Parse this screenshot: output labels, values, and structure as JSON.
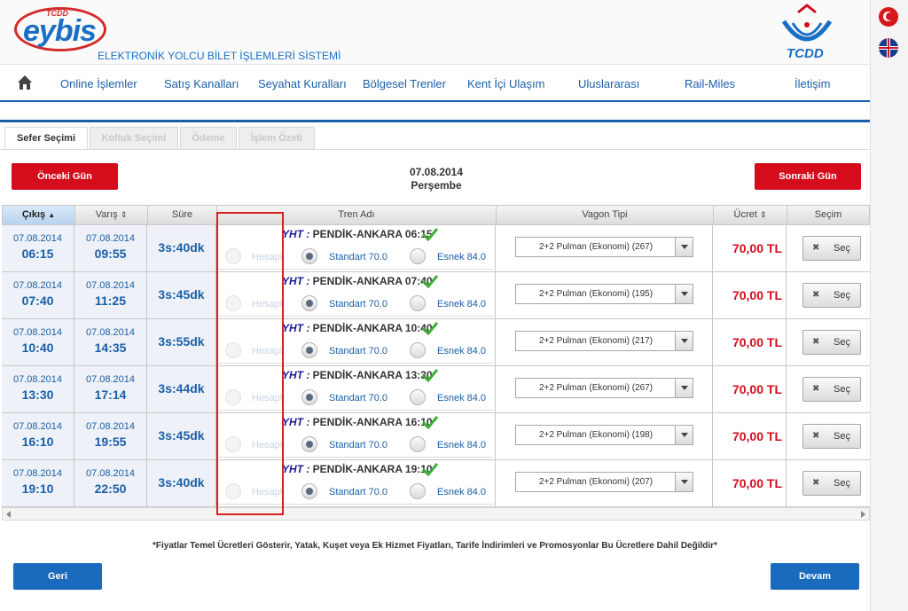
{
  "header": {
    "logo_small": "TCDD",
    "logo_main": "eybis",
    "site_title": "ELEKTRONİK YOLCU BİLET İŞLEMLERİ SİSTEMİ",
    "brand": "TCDD"
  },
  "nav": {
    "items": [
      "Online İşlemler",
      "Satış Kanalları",
      "Seyahat Kuralları",
      "Bölgesel Trenler",
      "Kent İçi Ulaşım",
      "Uluslararası",
      "Rail-Miles",
      "İletişim"
    ]
  },
  "tabs": [
    "Sefer Seçimi",
    "Koltuk Seçimi",
    "Ödeme",
    "İşlem Özeti"
  ],
  "date_nav": {
    "prev": "Önceki Gün",
    "next": "Sonraki Gün",
    "date": "07.08.2014",
    "weekday": "Perşembe"
  },
  "table": {
    "headers": {
      "departure": "Çıkış",
      "arrival": "Varış",
      "duration": "Süre",
      "train": "Tren Adı",
      "wagon": "Vagon Tipi",
      "price": "Ücret",
      "select": "Seçim"
    },
    "rows": [
      {
        "dep_date": "07.08.2014",
        "dep_time": "06:15",
        "arr_date": "07.08.2014",
        "arr_time": "09:55",
        "duration": "3s:40dk",
        "train_prefix": "YHT :",
        "train_name": " PENDİK-ANKARA 06:15",
        "opt1": "Hesaplı",
        "opt2": "Standart 70.0",
        "opt3": "Esnek 84.0",
        "wagon": "2+2 Pulman (Ekonomi) (267)",
        "price": "70,00 TL",
        "btn": "Seç"
      },
      {
        "dep_date": "07.08.2014",
        "dep_time": "07:40",
        "arr_date": "07.08.2014",
        "arr_time": "11:25",
        "duration": "3s:45dk",
        "train_prefix": "YHT :",
        "train_name": " PENDİK-ANKARA 07:40",
        "opt1": "Hesaplı",
        "opt2": "Standart 70.0",
        "opt3": "Esnek 84.0",
        "wagon": "2+2 Pulman (Ekonomi) (195)",
        "price": "70,00 TL",
        "btn": "Seç"
      },
      {
        "dep_date": "07.08.2014",
        "dep_time": "10:40",
        "arr_date": "07.08.2014",
        "arr_time": "14:35",
        "duration": "3s:55dk",
        "train_prefix": "YHT :",
        "train_name": " PENDİK-ANKARA 10:40",
        "opt1": "Hesaplı",
        "opt2": "Standart 70.0",
        "opt3": "Esnek 84.0",
        "wagon": "2+2 Pulman (Ekonomi) (217)",
        "price": "70,00 TL",
        "btn": "Seç"
      },
      {
        "dep_date": "07.08.2014",
        "dep_time": "13:30",
        "arr_date": "07.08.2014",
        "arr_time": "17:14",
        "duration": "3s:44dk",
        "train_prefix": "YHT :",
        "train_name": " PENDİK-ANKARA 13:30",
        "opt1": "Hesaplı",
        "opt2": "Standart 70.0",
        "opt3": "Esnek 84.0",
        "wagon": "2+2 Pulman (Ekonomi) (267)",
        "price": "70,00 TL",
        "btn": "Seç"
      },
      {
        "dep_date": "07.08.2014",
        "dep_time": "16:10",
        "arr_date": "07.08.2014",
        "arr_time": "19:55",
        "duration": "3s:45dk",
        "train_prefix": "YHT :",
        "train_name": " PENDİK-ANKARA 16:10",
        "opt1": "Hesaplı",
        "opt2": "Standart 70.0",
        "opt3": "Esnek 84.0",
        "wagon": "2+2 Pulman (Ekonomi) (198)",
        "price": "70,00 TL",
        "btn": "Seç"
      },
      {
        "dep_date": "07.08.2014",
        "dep_time": "19:10",
        "arr_date": "07.08.2014",
        "arr_time": "22:50",
        "duration": "3s:40dk",
        "train_prefix": "YHT :",
        "train_name": " PENDİK-ANKARA 19:10",
        "opt1": "Hesaplı",
        "opt2": "Standart 70.0",
        "opt3": "Esnek 84.0",
        "wagon": "2+2 Pulman (Ekonomi) (207)",
        "price": "70,00 TL",
        "btn": "Seç"
      }
    ]
  },
  "footnote": "*Fiyatlar Temel Ücretleri Gösterir, Yatak, Kuşet veya Ek Hizmet Fiyatları, Tarife İndirimleri ve Promosyonlar Bu Ücretlere Dahil Değildir*",
  "footer": {
    "back": "Geri",
    "continue": "Devam"
  },
  "colors": {
    "brand_blue": "#1a5fa8",
    "brand_red": "#d40c1c",
    "highlight": "#d82020"
  },
  "icons": [
    "home-icon",
    "check-icon",
    "sort-up-icon",
    "sort-icon",
    "close-icon",
    "chevron-down-icon",
    "turkish-flag-icon",
    "uk-flag-icon"
  ]
}
